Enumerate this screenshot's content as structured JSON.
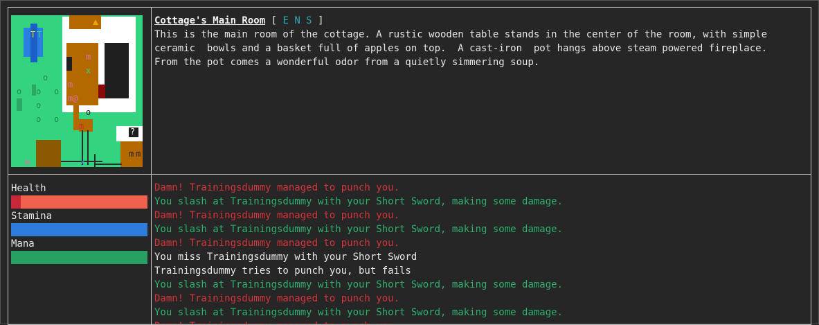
{
  "room": {
    "title": "Cottage's Main Room",
    "bracket_open": "[",
    "exits_label": "E N S",
    "bracket_close": "]",
    "description": "This is the main room of the cottage. A rustic wooden table stands in the center of the room, with simple\nceramic  bowls and a basket full of apples on top.  A cast-iron  pot hangs above steam powered fireplace.\nFrom the pot comes a wonderful odor from a quietly simmering soup."
  },
  "map": {
    "glyphs": [
      "T",
      "T",
      "m",
      "x",
      "0",
      "m",
      "m@",
      "o",
      "?",
      "m",
      "m",
      "x",
      "m",
      "o",
      "o",
      "o",
      "o",
      "o",
      "o",
      "o",
      "m"
    ]
  },
  "stats": {
    "health": {
      "label": "Health",
      "fraction": 0.07,
      "fill_color": "#c8283a",
      "track_color": "#f2604e"
    },
    "stamina": {
      "label": "Stamina",
      "fraction": 1.0,
      "fill_color": "#2e7ddc"
    },
    "mana": {
      "label": "Mana",
      "fraction": 1.0,
      "fill_color": "#27a064"
    }
  },
  "log": [
    {
      "text": "Damn! Trainingsdummy managed to punch you.",
      "kind": "damage"
    },
    {
      "text": "You slash at Trainingsdummy with your Short Sword, making some damage.",
      "kind": "hit"
    },
    {
      "text": "Damn! Trainingsdummy managed to punch you.",
      "kind": "damage"
    },
    {
      "text": "You slash at Trainingsdummy with your Short Sword, making some damage.",
      "kind": "hit"
    },
    {
      "text": "Damn! Trainingsdummy managed to punch you.",
      "kind": "damage"
    },
    {
      "text": "You miss Trainingsdummy with your Short Sword",
      "kind": "neutral"
    },
    {
      "text": "Trainingsdummy tries to punch you, but fails",
      "kind": "neutral"
    },
    {
      "text": "You slash at Trainingsdummy with your Short Sword, making some damage.",
      "kind": "hit"
    },
    {
      "text": "Damn! Trainingsdummy managed to punch you.",
      "kind": "damage"
    },
    {
      "text": "You slash at Trainingsdummy with your Short Sword, making some damage.",
      "kind": "hit"
    },
    {
      "text": "Damn! Trainingsdummy managed to punch you.",
      "kind": "damage"
    }
  ]
}
